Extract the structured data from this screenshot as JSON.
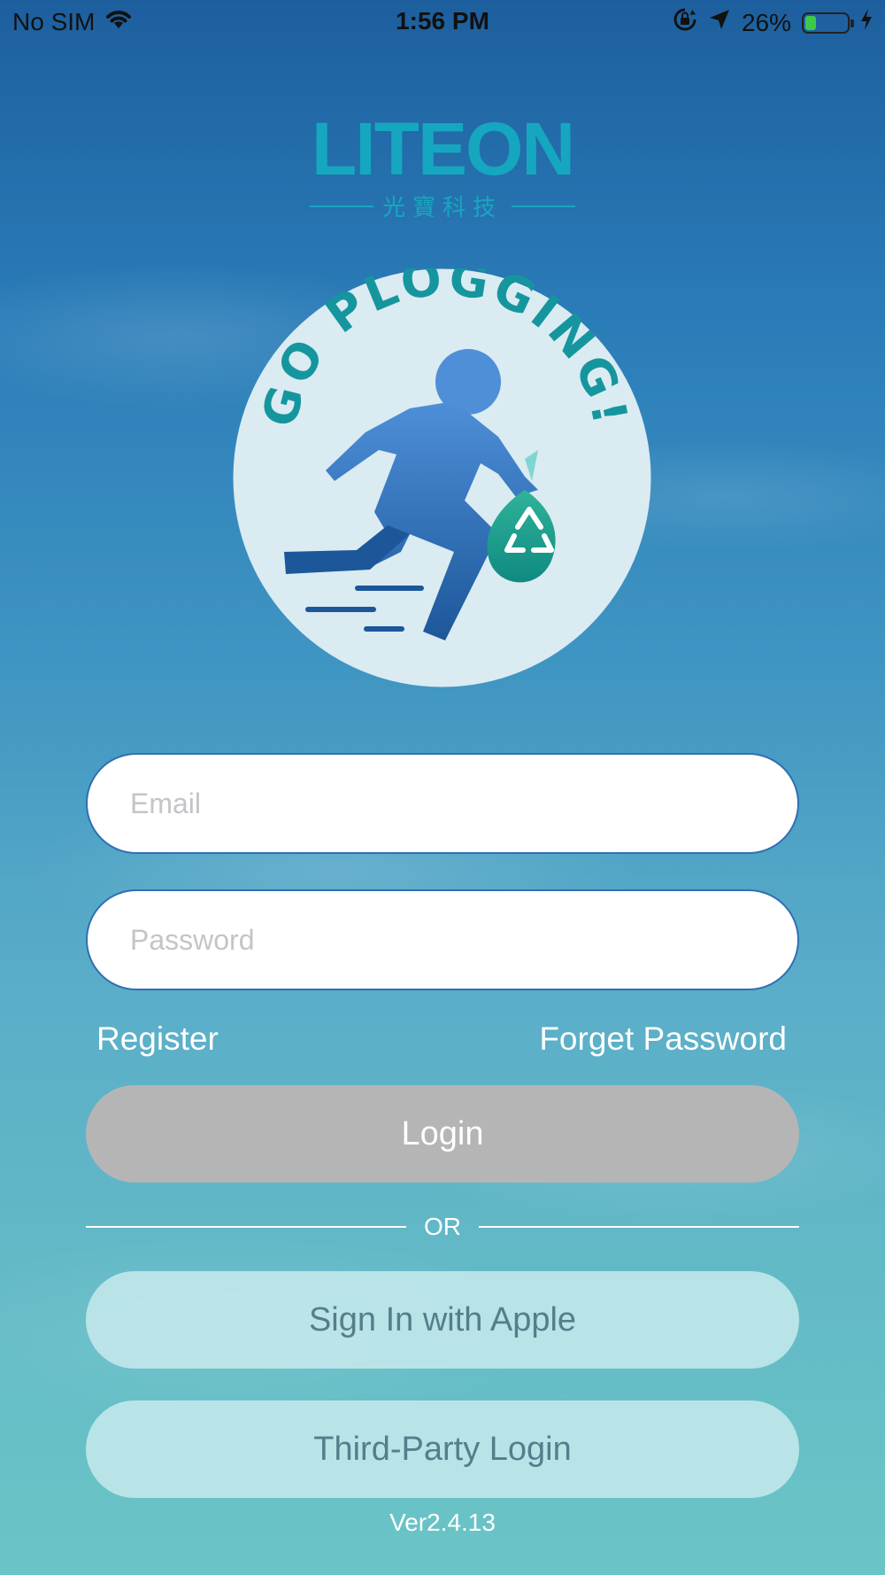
{
  "status_bar": {
    "carrier": "No SIM",
    "time": "1:56 PM",
    "battery_percent": "26%",
    "battery_level": 0.26,
    "icons": [
      "wifi-icon",
      "orientation-lock-icon",
      "location-arrow-icon",
      "battery-icon",
      "charging-bolt-icon"
    ]
  },
  "brand": {
    "name": "LITEON",
    "subtitle": "光寶科技",
    "color": "#16a7c0"
  },
  "emblem": {
    "text": "GO PLOGGING!",
    "icon": "runner-with-recycle-bag-icon"
  },
  "form": {
    "email_placeholder": "Email",
    "password_placeholder": "Password",
    "register_label": "Register",
    "forget_password_label": "Forget Password",
    "login_label": "Login",
    "or_label": "OR",
    "apple_label": "Sign In with Apple",
    "third_party_label": "Third-Party Login"
  },
  "version": "Ver2.4.13",
  "colors": {
    "login_button": "#b5b5b5",
    "field_border": "#2f6fb3",
    "soft_button": "#cbebee"
  }
}
